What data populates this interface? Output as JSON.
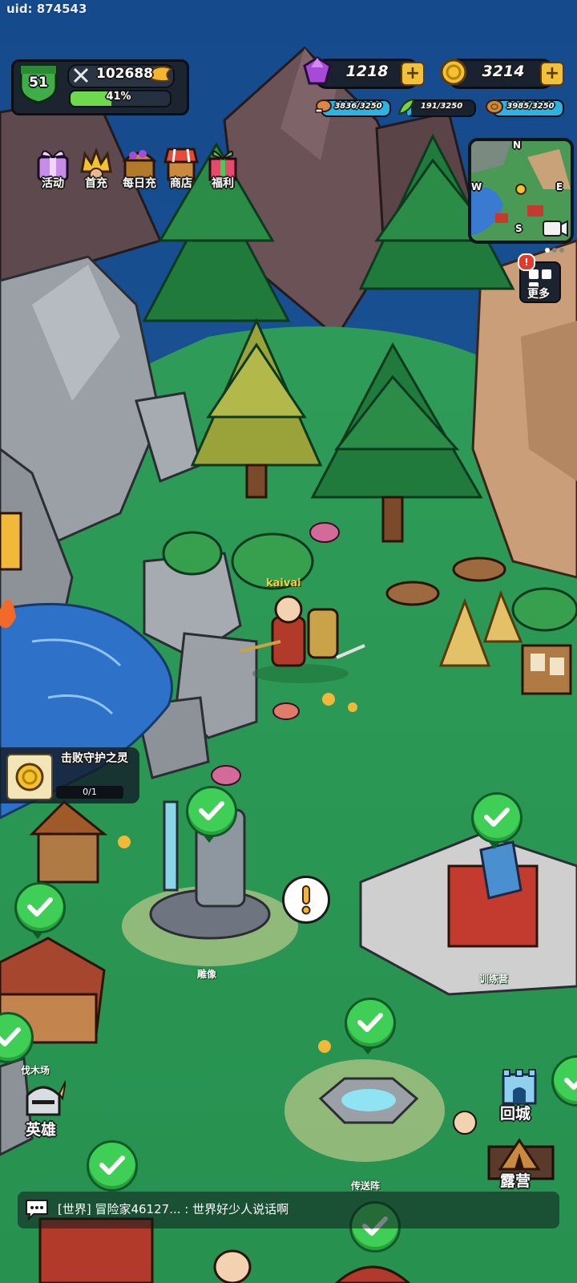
{
  "uid": "uid: 874543",
  "player": {
    "level": "51",
    "power": "102688",
    "xp_percent_text": "41%",
    "xp_fraction": 0.41
  },
  "currencies": {
    "gems": "1218",
    "gold": "3214"
  },
  "resources": [
    {
      "icon": "meat-icon",
      "value": "3836/3250",
      "fill": 1.0
    },
    {
      "icon": "herb-icon",
      "value": "191/3250",
      "fill": 0.06
    },
    {
      "icon": "wood-icon",
      "value": "3985/3250",
      "fill": 1.0
    }
  ],
  "activities": [
    {
      "icon": "gift-box-icon",
      "label": "活动"
    },
    {
      "icon": "crown-icon",
      "label": "首充"
    },
    {
      "icon": "treasure-chest-icon",
      "label": "每日充"
    },
    {
      "icon": "shop-stall-icon",
      "label": "商店"
    },
    {
      "icon": "present-icon",
      "label": "福利"
    }
  ],
  "minimap": {
    "n": "N",
    "s": "S",
    "e": "E",
    "w": "W"
  },
  "more_button": {
    "label": "更多",
    "badge": "!"
  },
  "player_name": "kaivai",
  "quest": {
    "title": "击败守护之灵",
    "progress": "0/1",
    "progress_fraction": 0
  },
  "buildings": [
    {
      "label": "雕像"
    },
    {
      "label": "训练营"
    },
    {
      "label": "伐木场"
    },
    {
      "label": "传送阵"
    }
  ],
  "side_buttons": {
    "hero": "英雄",
    "return_city": "回城",
    "camp": "露营"
  },
  "chat": {
    "message": "[世界] 冒险家46127... :  世界好少人说话啊"
  },
  "colors": {
    "grass": "#2d9a56",
    "check_green": "#3fcf57",
    "panel_dark": "#1c2430",
    "gold_button": "#f2c13a"
  }
}
